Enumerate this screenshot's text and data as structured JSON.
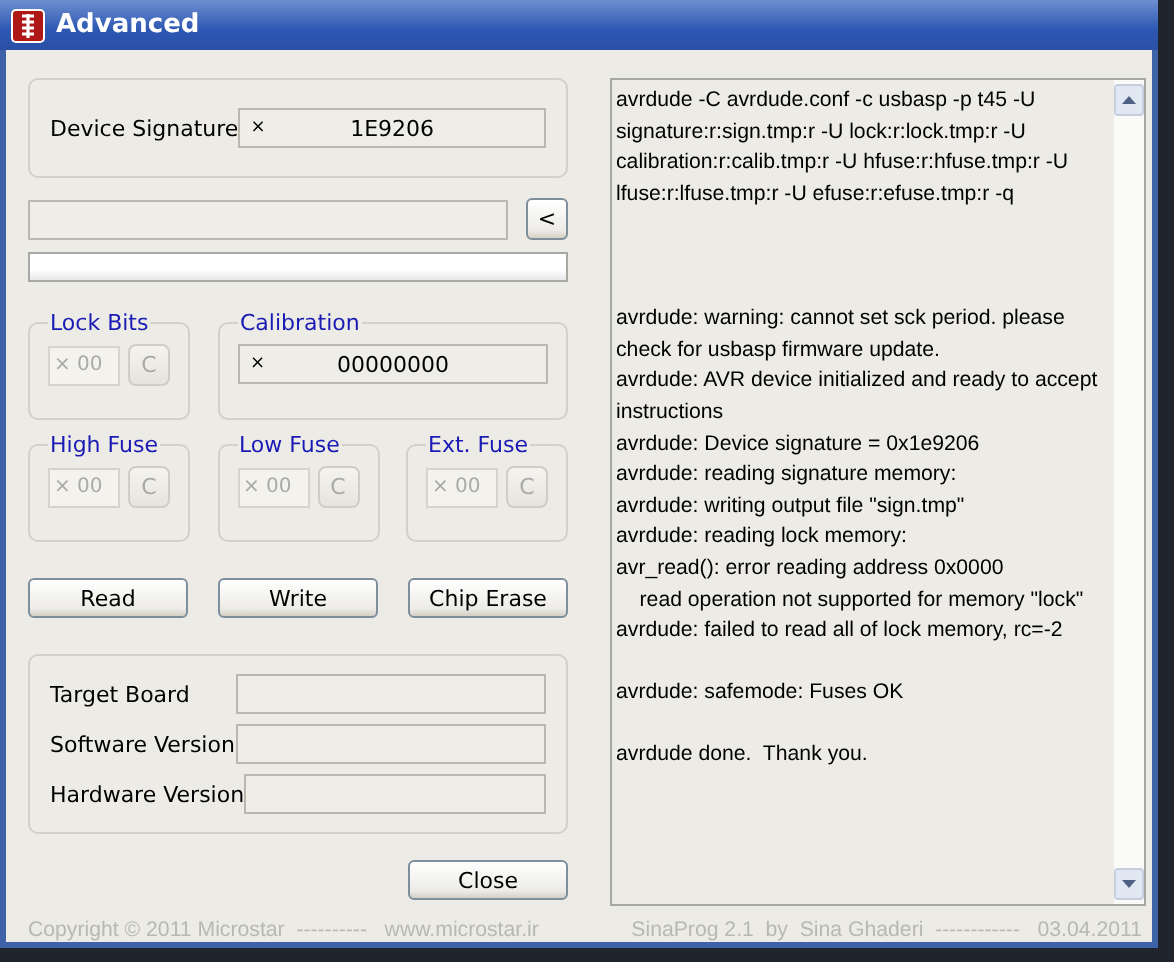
{
  "window": {
    "title": "Advanced"
  },
  "device_signature": {
    "label": "Device Signature",
    "prefix": "×",
    "value": "1E9206"
  },
  "browse_button": {
    "label": "<"
  },
  "progress": {
    "level": 0
  },
  "lock_bits": {
    "title": "Lock Bits",
    "prefix": "×",
    "value": "00",
    "button": "C",
    "disabled": true
  },
  "calibration": {
    "title": "Calibration",
    "prefix": "×",
    "value": "00000000"
  },
  "fuses": [
    {
      "title": "High Fuse",
      "prefix": "×",
      "value": "00",
      "button": "C",
      "disabled": true
    },
    {
      "title": "Low Fuse",
      "prefix": "×",
      "value": "00",
      "button": "C",
      "disabled": true
    },
    {
      "title": "Ext. Fuse",
      "prefix": "×",
      "value": "00",
      "button": "C",
      "disabled": true
    }
  ],
  "actions": [
    {
      "label": "Read"
    },
    {
      "label": "Write"
    },
    {
      "label": "Chip Erase"
    }
  ],
  "info": [
    {
      "label": "Target Board"
    },
    {
      "label": "Software Version"
    },
    {
      "label": "Hardware Version"
    }
  ],
  "close_button": {
    "label": "Close"
  },
  "log": {
    "lines": [
      {
        "kind": "text",
        "text": "avrdude -C avrdude.conf -c usbasp -p t45 -U"
      },
      {
        "kind": "text",
        "text": "signature:r:sign.tmp:r -U lock:r:lock.tmp:r -U"
      },
      {
        "kind": "text",
        "text": "calibration:r:calib.tmp:r -U hfuse:r:hfuse.tmp:r -U"
      },
      {
        "kind": "text",
        "text": "lfuse:r:lfuse.tmp:r -U efuse:r:efuse.tmp:r -q"
      },
      {
        "kind": "blank"
      },
      {
        "kind": "blank"
      },
      {
        "kind": "blank"
      },
      {
        "kind": "text",
        "text": "avrdude: warning: cannot set sck period. please"
      },
      {
        "kind": "text",
        "text": "check for usbasp firmware update."
      },
      {
        "kind": "text",
        "text": "avrdude: AVR device initialized and ready to accept"
      },
      {
        "kind": "text",
        "text": "instructions"
      },
      {
        "kind": "text",
        "text": "avrdude: Device signature = 0x1e9206"
      },
      {
        "kind": "text",
        "text": "avrdude: reading signature memory:"
      },
      {
        "kind": "text",
        "text": "avrdude: writing output file \"sign.tmp\""
      },
      {
        "kind": "text",
        "text": "avrdude: reading lock memory:"
      },
      {
        "kind": "text",
        "text": "avr_read(): error reading address 0x0000"
      },
      {
        "kind": "text",
        "text": "    read operation not supported for memory \"lock\""
      },
      {
        "kind": "text",
        "text": "avrdude: failed to read all of lock memory, rc=-2"
      },
      {
        "kind": "blank"
      },
      {
        "kind": "text",
        "text": "avrdude: safemode: Fuses OK"
      },
      {
        "kind": "blank"
      },
      {
        "kind": "text",
        "text": "avrdude done.  Thank you."
      }
    ]
  },
  "footer": {
    "left": "Copyright © 2011 Microstar  ----------   www.microstar.ir",
    "right": "SinaProg 2.1  by  Sina Ghaderi  ------------   03.04.2011"
  }
}
